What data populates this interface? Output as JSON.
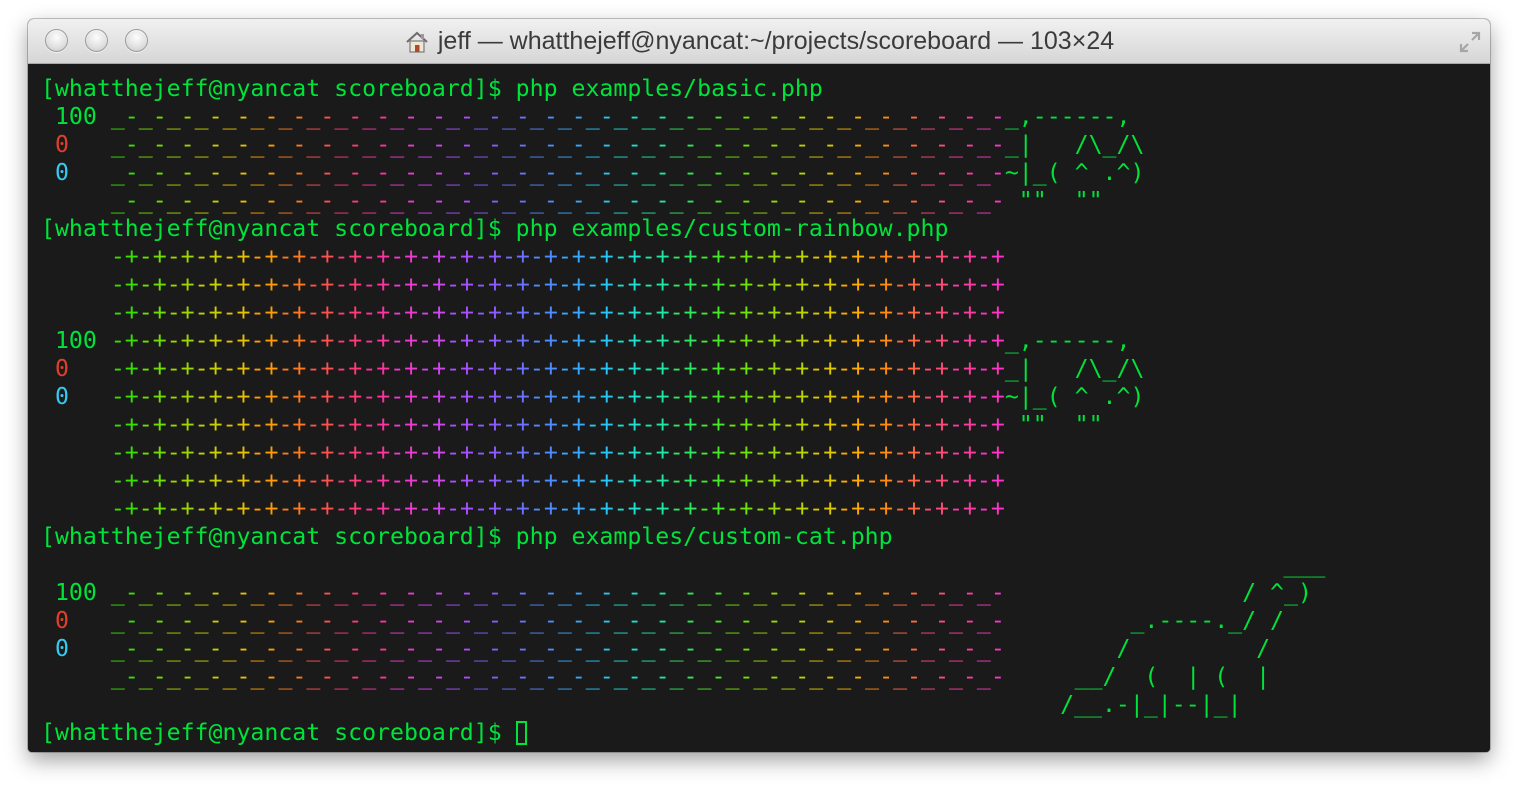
{
  "window": {
    "title": "jeff — whatthejeff@nyancat:~/projects/scoreboard — 103×24"
  },
  "colors": {
    "text": "#00e33a",
    "red": "#e0402a",
    "cyan": "#36c9f2",
    "background": "#1a1a1a"
  },
  "rainbow": [
    "#38e000",
    "#6ee000",
    "#9ed600",
    "#c8d000",
    "#e8c000",
    "#ff9c00",
    "#ff7a1e",
    "#ff5050",
    "#ff3a78",
    "#ff33a0",
    "#ef3ad2",
    "#cf45f0",
    "#a850ff",
    "#8a5cff",
    "#6a72ff",
    "#4e8cff",
    "#38a8ff",
    "#26c6f6",
    "#1ee0d2",
    "#1ee8a0",
    "#2ee85c",
    "#46e828",
    "#6ee400",
    "#96dc00",
    "#bcd400",
    "#e0c800",
    "#ffaa00",
    "#ff8c0a",
    "#ff6a40",
    "#ff4a78",
    "#ff3aa4",
    "#ff33c8"
  ],
  "terminal": {
    "prompt": "[whatthejeff@nyancat scoreboard]$ ",
    "commands": [
      "php examples/basic.php",
      "php examples/custom-rainbow.php",
      "php examples/custom-cat.php"
    ],
    "scores": {
      "top": "100",
      "red": "0",
      "cyan": "0"
    },
    "patterns": {
      "basic": "_-",
      "custom": "-+"
    },
    "cat": [
      "_,------,",
      "_|   /\\_/\\",
      "~|_( ^ .^)",
      " \"\"  \"\""
    ],
    "dino": [
      "                  ___",
      "                 / ^_)",
      "         _.----._/ /",
      "        /         /",
      "     __/  (  | (  |",
      "    /__.-|_|--|_|"
    ]
  }
}
